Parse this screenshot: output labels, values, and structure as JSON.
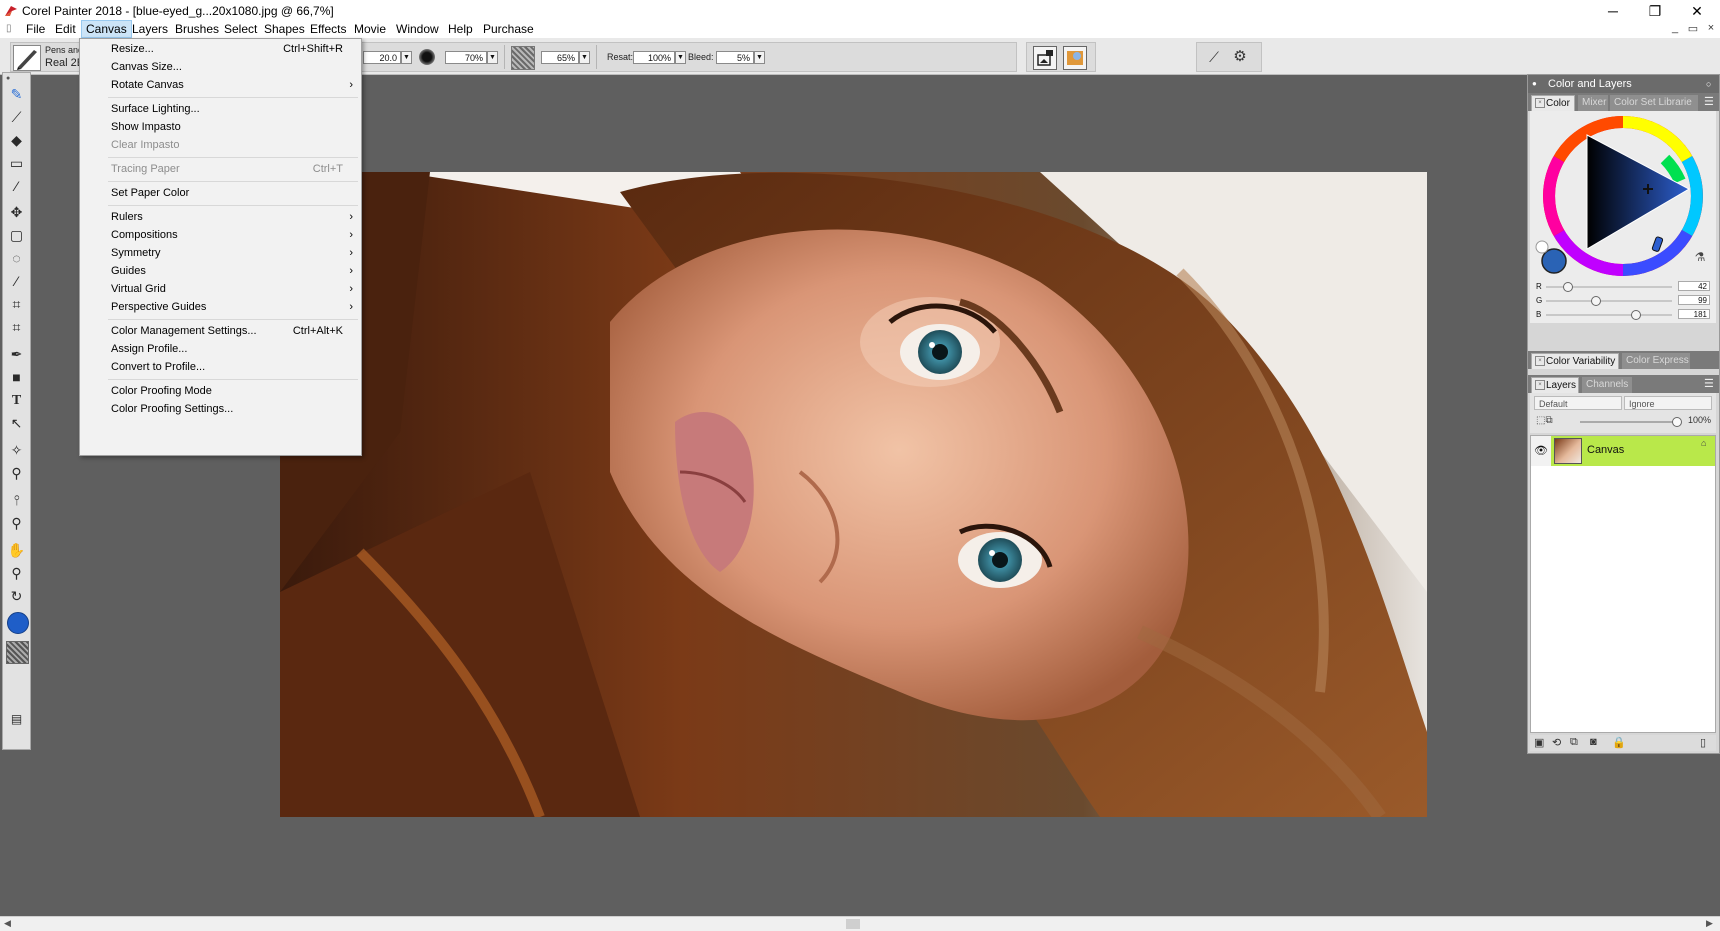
{
  "window": {
    "title": "Corel Painter 2018 - [blue-eyed_g...20x1080.jpg @ 66,7%]",
    "minimize": "─",
    "restore": "❐",
    "close": "✕"
  },
  "menubar": {
    "items": [
      "File",
      "Edit",
      "Canvas",
      "Layers",
      "Brushes",
      "Select",
      "Shapes",
      "Effects",
      "Movie",
      "Window",
      "Help",
      "Purchase"
    ],
    "active": "Canvas",
    "mdi_minimize": "_",
    "mdi_restore": "▭",
    "mdi_close": "×"
  },
  "propbar": {
    "brush_category": "Pens and",
    "brush_variant": "Real 2E",
    "size_value": "20.0",
    "opacity_value": "70%",
    "grain_value": "65%",
    "resat_label": "Resat:",
    "resat_value": "100%",
    "bleed_label": "Bleed:",
    "bleed_value": "5%"
  },
  "canvas_menu": {
    "items": [
      {
        "label": "Resize...",
        "shortcut": "Ctrl+Shift+R",
        "submenu": false,
        "disabled": false
      },
      {
        "label": "Canvas Size...",
        "shortcut": "",
        "submenu": false,
        "disabled": false
      },
      {
        "label": "Rotate Canvas",
        "shortcut": "",
        "submenu": true,
        "disabled": false
      },
      {
        "label": "Surface Lighting...",
        "shortcut": "",
        "submenu": false,
        "disabled": false
      },
      {
        "label": "Show Impasto",
        "shortcut": "",
        "submenu": false,
        "disabled": false
      },
      {
        "label": "Clear Impasto",
        "shortcut": "",
        "submenu": false,
        "disabled": true
      },
      {
        "label": "Tracing Paper",
        "shortcut": "Ctrl+T",
        "submenu": false,
        "disabled": true
      },
      {
        "label": "Set Paper Color",
        "shortcut": "",
        "submenu": false,
        "disabled": false
      },
      {
        "label": "Rulers",
        "shortcut": "",
        "submenu": true,
        "disabled": false
      },
      {
        "label": "Compositions",
        "shortcut": "",
        "submenu": true,
        "disabled": false
      },
      {
        "label": "Symmetry",
        "shortcut": "",
        "submenu": true,
        "disabled": false
      },
      {
        "label": "Guides",
        "shortcut": "",
        "submenu": true,
        "disabled": false
      },
      {
        "label": "Virtual Grid",
        "shortcut": "",
        "submenu": true,
        "disabled": false
      },
      {
        "label": "Perspective Guides",
        "shortcut": "",
        "submenu": true,
        "disabled": false
      },
      {
        "label": "Color Management Settings...",
        "shortcut": "Ctrl+Alt+K",
        "submenu": false,
        "disabled": false
      },
      {
        "label": "Assign Profile...",
        "shortcut": "",
        "submenu": false,
        "disabled": false
      },
      {
        "label": "Convert to Profile...",
        "shortcut": "",
        "submenu": false,
        "disabled": false
      },
      {
        "label": "Color Proofing Mode",
        "shortcut": "",
        "submenu": false,
        "disabled": false
      },
      {
        "label": "Color Proofing Settings...",
        "shortcut": "",
        "submenu": false,
        "disabled": false
      }
    ],
    "submenu_arrow": "›"
  },
  "color_panel": {
    "title": "Color and Layers",
    "tabs": [
      "Color",
      "Mixer",
      "Color Set Librarie"
    ],
    "channels": [
      {
        "name": "R",
        "value": "42",
        "fraction": 0.165
      },
      {
        "name": "G",
        "value": "99",
        "fraction": 0.388
      },
      {
        "name": "B",
        "value": "181",
        "fraction": 0.71
      }
    ],
    "main_color": "#2a63b5",
    "variability_tabs": [
      "Color Variability",
      "Color Express"
    ]
  },
  "layers_panel": {
    "tabs": [
      "Layers",
      "Channels"
    ],
    "composite_method": "Default",
    "composite_depth": "Ignore",
    "opacity": "100%",
    "layer_name": "Canvas",
    "selected_color": "#b9e84a"
  },
  "toolbox": {
    "tools": [
      "brush-tool",
      "dropper-tool",
      "paint-bucket-tool",
      "eraser-tool",
      "blender-tool",
      "transform-tool",
      "rectangle-select-tool",
      "lasso-tool",
      "magic-wand-tool",
      "crop-select-tool",
      "crop-tool",
      "pen-tool",
      "shape-tool",
      "text-tool",
      "shape-selection-tool",
      "cloner-tool",
      "dodge-tool",
      "burn-tool",
      "mirror-tool",
      "grabber-tool",
      "magnifier-tool",
      "rotate-page-tool"
    ],
    "main_color": "#1f5ec8"
  }
}
